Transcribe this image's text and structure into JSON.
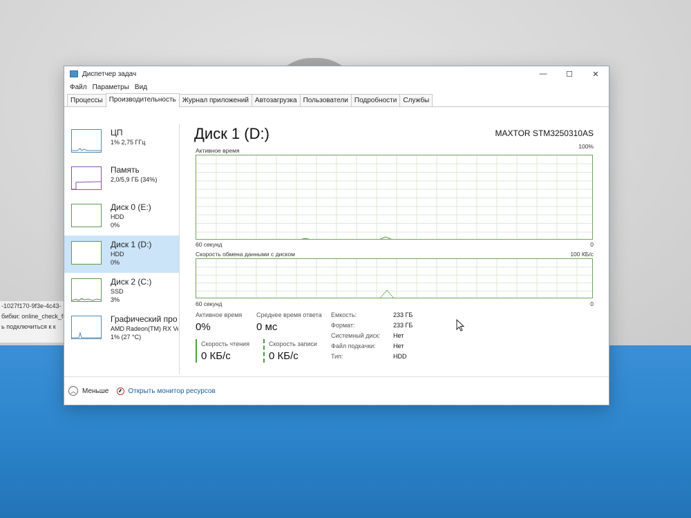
{
  "background_text": [
    "-1027f170-9f3e-4c43-",
    "бибки: online_check_fail",
    "ь подключиться к к"
  ],
  "window": {
    "title": "Диспетчер задач",
    "controls": {
      "minimize": "—",
      "maximize": "☐",
      "close": "✕"
    }
  },
  "menu": [
    "Файл",
    "Параметры",
    "Вид"
  ],
  "tabs": [
    {
      "label": "Процессы",
      "active": false
    },
    {
      "label": "Производительность",
      "active": true
    },
    {
      "label": "Журнал приложений",
      "active": false
    },
    {
      "label": "Автозагрузка",
      "active": false
    },
    {
      "label": "Пользователи",
      "active": false
    },
    {
      "label": "Подробности",
      "active": false
    },
    {
      "label": "Службы",
      "active": false
    }
  ],
  "sidebar": [
    {
      "title": "ЦП",
      "line1": "1% 2,75 ГГц",
      "line2": ""
    },
    {
      "title": "Память",
      "line1": "2,0/5,9 ГБ (34%)",
      "line2": ""
    },
    {
      "title": "Диск 0 (E:)",
      "line1": "HDD",
      "line2": "0%"
    },
    {
      "title": "Диск 1 (D:)",
      "line1": "HDD",
      "line2": "0%"
    },
    {
      "title": "Диск 2 (C:)",
      "line1": "SSD",
      "line2": "3%"
    },
    {
      "title": "Графический про",
      "line1": "AMD Radeon(TM) RX Ve",
      "line2": "1% (27 °C)"
    }
  ],
  "main": {
    "title": "Диск 1 (D:)",
    "model": "MAXTOR STM3250310AS",
    "active_time_graph": {
      "label": "Активное время",
      "max": "100%",
      "x_left": "60 секунд",
      "x_right": "0"
    },
    "transfer_graph": {
      "label": "Скорость обмена данными с диском",
      "max": "100 КБ/с",
      "x_left": "60 секунд",
      "x_right": "0"
    },
    "stats": {
      "active_time_label": "Активное время",
      "active_time_value": "0%",
      "response_label": "Среднее время ответа",
      "response_value": "0 мс",
      "read_label": "Скорость чтения",
      "read_value": "0 КБ/с",
      "write_label": "Скорость записи",
      "write_value": "0 КБ/с"
    },
    "properties": [
      {
        "key": "Емкость:",
        "value": "233 ГБ"
      },
      {
        "key": "Формат:",
        "value": "233 ГБ"
      },
      {
        "key": "Системный диск:",
        "value": "Нет"
      },
      {
        "key": "Файл подкачки:",
        "value": "Нет"
      },
      {
        "key": "Тип:",
        "value": "HDD"
      }
    ]
  },
  "footer": {
    "less_label": "Меньше",
    "monitor_label": "Открыть монитор ресурсов"
  },
  "colors": {
    "accent_green": "#4c9c3a",
    "selection": "#cce4f7",
    "link": "#1a5fa3"
  }
}
